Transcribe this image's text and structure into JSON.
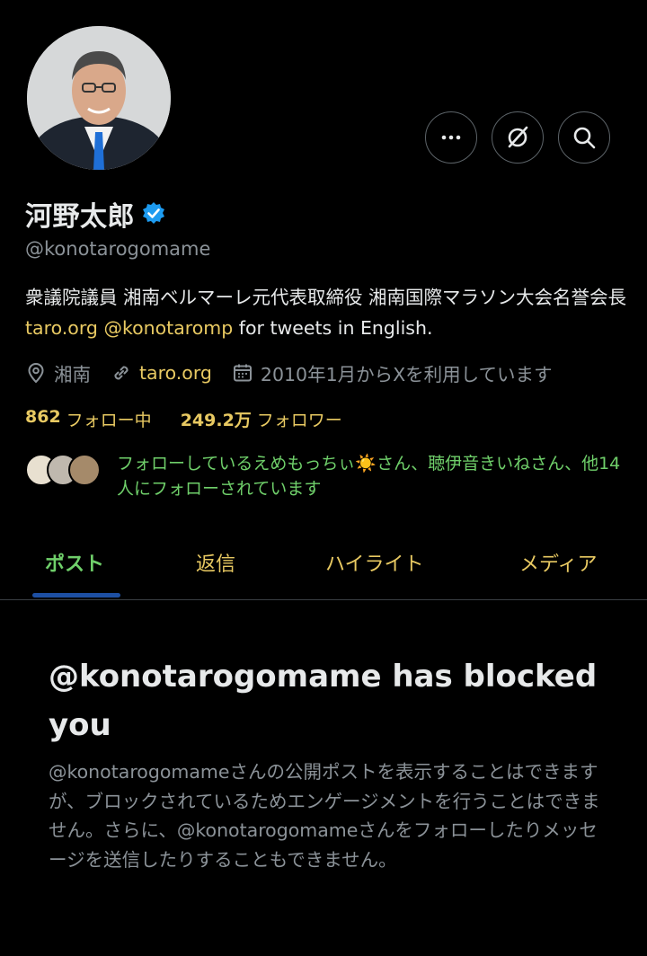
{
  "profile": {
    "display_name": "河野太郎",
    "handle": "@konotarogomame",
    "verified": true,
    "bio": {
      "text": "衆議院議員 湘南ベルマーレ元代表取締役 湘南国際マラソン大会名誉会長 ",
      "link1": "taro.org",
      "link2": "@konotaromp",
      "suffix": " for tweets in English."
    },
    "location": "湘南",
    "website": "taro.org",
    "joined": "2010年1月からXを利用しています",
    "following_count": "862",
    "following_label": "フォロー中",
    "followers_count": "249.2万",
    "followers_label": "フォロワー",
    "followed_by": "フォローしているえめもっちぃ☀️さん、聴伊音きいねさん、他14人にフォローされています"
  },
  "actions": {
    "more": "more-icon",
    "grok": "grok-icon",
    "search": "search-icon"
  },
  "tabs": [
    {
      "label": "ポスト",
      "active": true
    },
    {
      "label": "返信",
      "active": false
    },
    {
      "label": "ハイライト",
      "active": false
    },
    {
      "label": "メディア",
      "active": false
    }
  ],
  "blocked": {
    "title": "@konotarogomame has blocked you",
    "body": "@konotarogomameさんの公開ポストを表示することはできますが、ブロックされているためエンゲージメントを行うことはできません。さらに、@konotarogomameさんをフォローしたりメッセージを送信したりすることもできません。"
  },
  "colors": {
    "background": "#000000",
    "accent_yellow": "#e8c962",
    "accent_green": "#6fcf6a",
    "tab_indicator": "#1d4fa3",
    "verified_badge": "#1d9bf0"
  }
}
